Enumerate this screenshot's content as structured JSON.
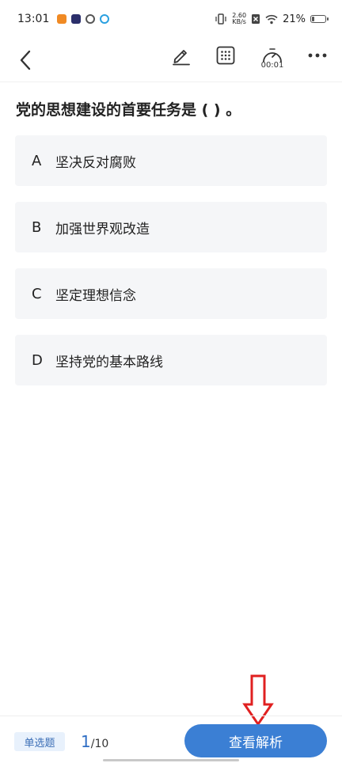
{
  "status_bar": {
    "time": "13:01",
    "net_speed_value": "2.60",
    "net_speed_unit": "KB/s",
    "battery_percent": "21%",
    "battery_level": 0.21
  },
  "toolbar": {
    "timer": "00:01"
  },
  "question": {
    "text": "党的思想建设的首要任务是 ( ) 。",
    "options": [
      {
        "letter": "A",
        "text": "坚决反对腐败"
      },
      {
        "letter": "B",
        "text": "加强世界观改造"
      },
      {
        "letter": "C",
        "text": "坚定理想信念"
      },
      {
        "letter": "D",
        "text": "坚持党的基本路线"
      }
    ]
  },
  "bottom": {
    "type_label": "单选题",
    "current": "1",
    "separator": "/",
    "total": "10",
    "analysis_label": "查看解析"
  },
  "colors": {
    "accent": "#3b7fd4",
    "annotation_arrow": "#e02020"
  }
}
